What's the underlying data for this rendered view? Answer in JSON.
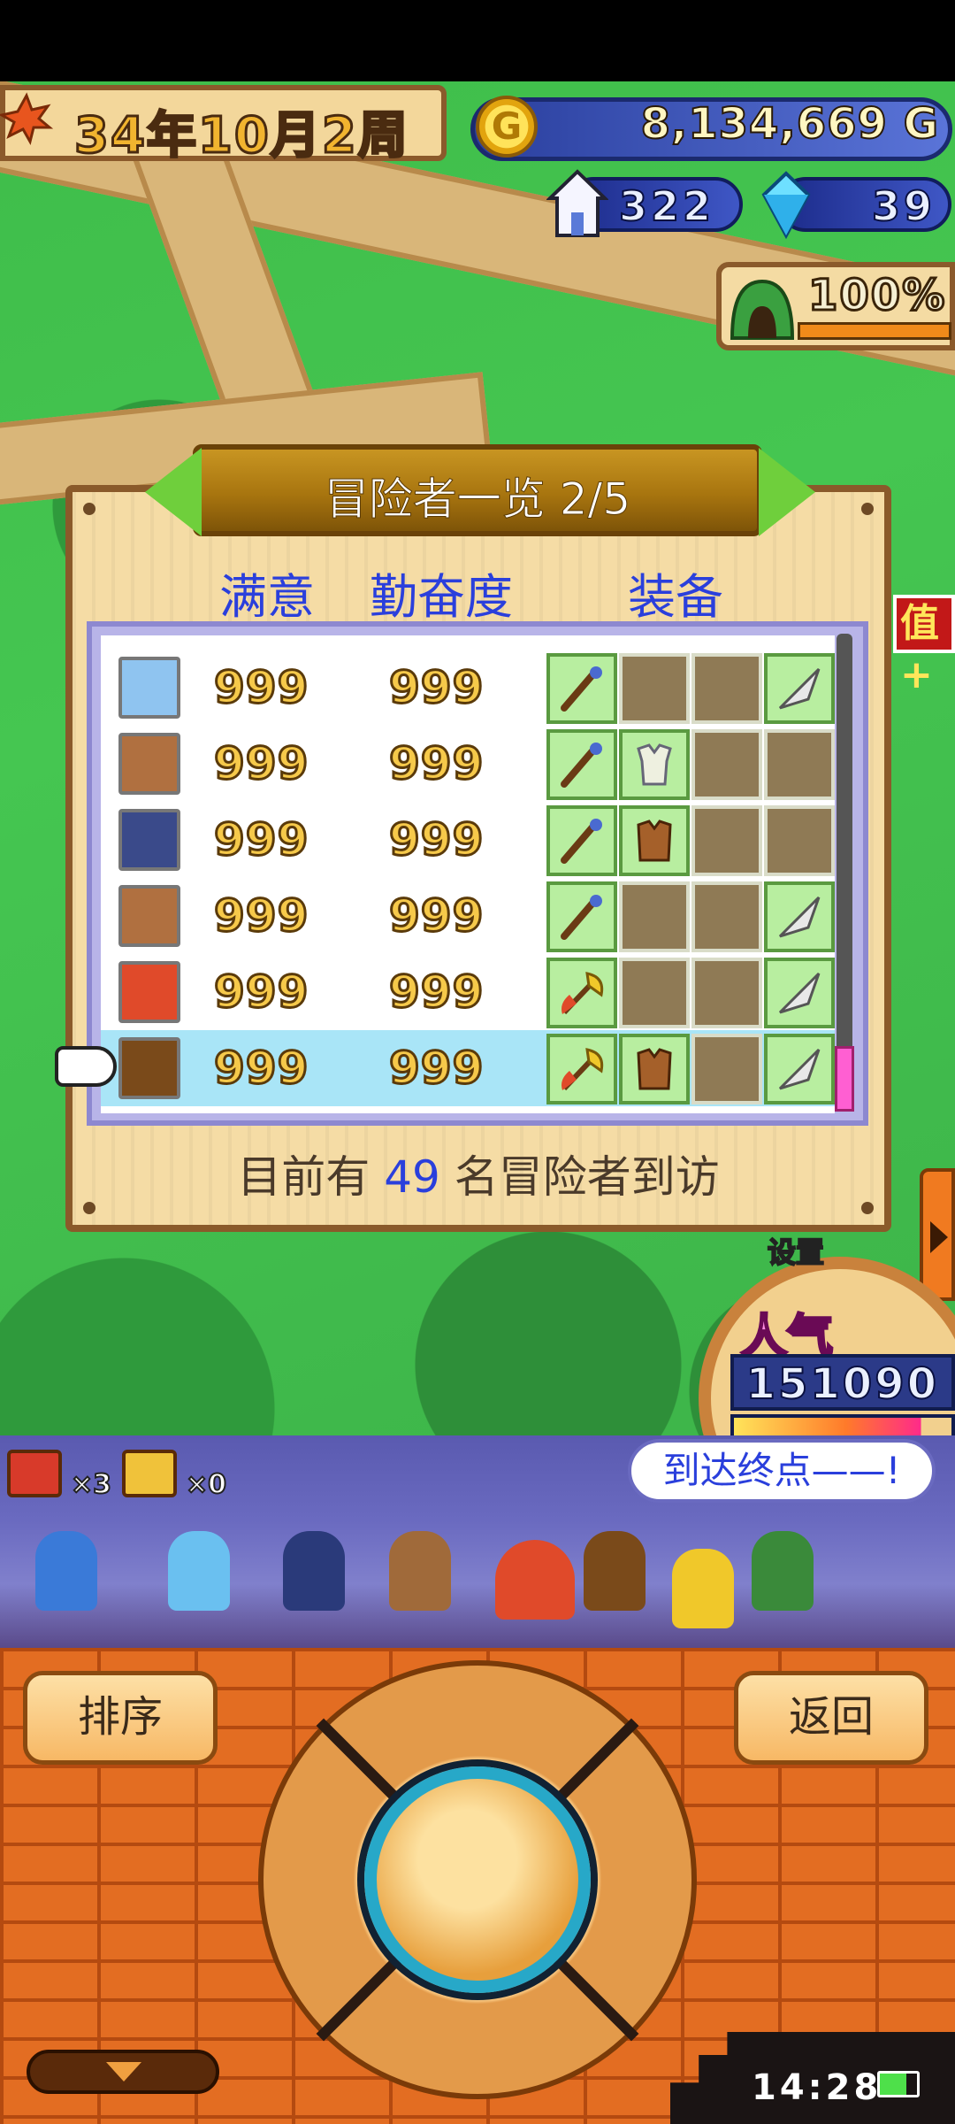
{
  "hud": {
    "date_label": "34年10月2周",
    "coin_symbol": "G",
    "gold": "8,134,669 G",
    "stat1": "322",
    "stat2": "39",
    "facility_pct": "100%"
  },
  "panel": {
    "title": "冒险者一览 2/5",
    "col_satisfaction": "满意",
    "col_diligence": "勤奋度",
    "col_equipment": "装备",
    "footer_prefix": "目前有",
    "footer_count": "49",
    "footer_suffix": "名冒险者到访"
  },
  "adventurers": [
    {
      "satisfaction": "999",
      "diligence": "999",
      "portrait_color": "#8fc4f0",
      "equipment": [
        "staff-icon",
        "empty",
        "empty",
        "arrowhead-icon"
      ],
      "selected": false
    },
    {
      "satisfaction": "999",
      "diligence": "999",
      "portrait_color": "#b07040",
      "equipment": [
        "staff-icon",
        "cloth-armor-icon",
        "empty",
        "empty"
      ],
      "selected": false
    },
    {
      "satisfaction": "999",
      "diligence": "999",
      "portrait_color": "#3a4a8a",
      "equipment": [
        "staff-icon",
        "leather-armor-icon",
        "empty",
        "empty"
      ],
      "selected": false
    },
    {
      "satisfaction": "999",
      "diligence": "999",
      "portrait_color": "#b07040",
      "equipment": [
        "staff-icon",
        "empty",
        "empty",
        "arrowhead-icon"
      ],
      "selected": false
    },
    {
      "satisfaction": "999",
      "diligence": "999",
      "portrait_color": "#e04a2a",
      "equipment": [
        "axe-icon",
        "empty",
        "empty",
        "arrowhead-icon"
      ],
      "selected": false
    },
    {
      "satisfaction": "999",
      "diligence": "999",
      "portrait_color": "#7a4a1a",
      "equipment": [
        "axe-icon",
        "leather-armor-icon",
        "empty",
        "arrowhead-icon"
      ],
      "selected": true
    }
  ],
  "side": {
    "value_badge": "值+",
    "settings_label": "设置",
    "popularity_label": "人气",
    "popularity_value": "151090",
    "popularity_level": 0.86
  },
  "parade": {
    "red_chest_count": "×3",
    "gold_chest_count": "×0",
    "speech": "到达终点——!"
  },
  "controls": {
    "sort_label": "排序",
    "back_label": "返回"
  },
  "clock": "14:28",
  "colors": {
    "accent_blue": "#2a3fdc",
    "panel_bg": "#f5dca5",
    "selected_row": "#a9e5f7",
    "brick": "#e36d22"
  }
}
